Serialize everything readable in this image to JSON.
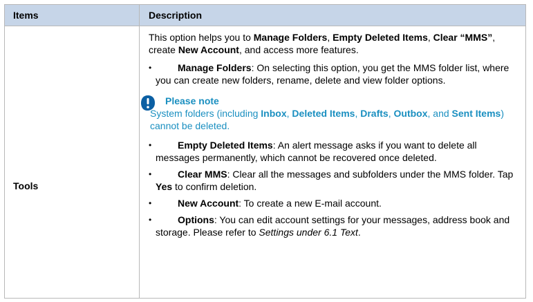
{
  "table": {
    "headers": {
      "items": "Items",
      "description": "Description"
    },
    "row_item": "Tools",
    "intro": {
      "t1": "This option helps you to ",
      "b1": "Manage Folders",
      "t2": ", ",
      "b2": "Empty Deleted Items",
      "t3": ", ",
      "b3": "Clear “MMS”",
      "t4": ", create ",
      "b4": "New Account",
      "t5": ", and access more features."
    },
    "bullets": {
      "manage": {
        "label": "Manage Folders",
        "text": ": On selecting this option, you get the MMS folder list, where you can create new folders, rename, delete and view folder options."
      },
      "empty": {
        "label": "Empty Deleted Items",
        "text": ": An alert message asks if you want to delete all messages permanently, which cannot be recovered once deleted."
      },
      "clear": {
        "label": "Clear MMS",
        "text": ": Clear all the messages and subfolders under the MMS folder. Tap ",
        "yes": "Yes",
        "text2": " to confirm deletion."
      },
      "account": {
        "label": "New Account",
        "text": ": To create a new E-mail account."
      },
      "options": {
        "label": "Options",
        "text": ": You can edit account settings for your messages, address book and storage. Please refer to ",
        "ref": "Settings under 6.1 Text",
        "end": "."
      }
    },
    "note": {
      "title": "Please note",
      "t1": "System folders (including ",
      "b1": "Inbox",
      "t2": ", ",
      "b2": "Deleted Items",
      "t3": ", ",
      "b3": "Drafts",
      "t4": ", ",
      "b4": "Outbox",
      "t5": ", and ",
      "b5": "Sent Items",
      "t6": ") cannot be deleted.",
      "icon": "exclamation-icon",
      "color": "#1a8fc0"
    },
    "colors": {
      "header_bg": "#c6d5e8",
      "border": "#b8b8b8"
    }
  }
}
